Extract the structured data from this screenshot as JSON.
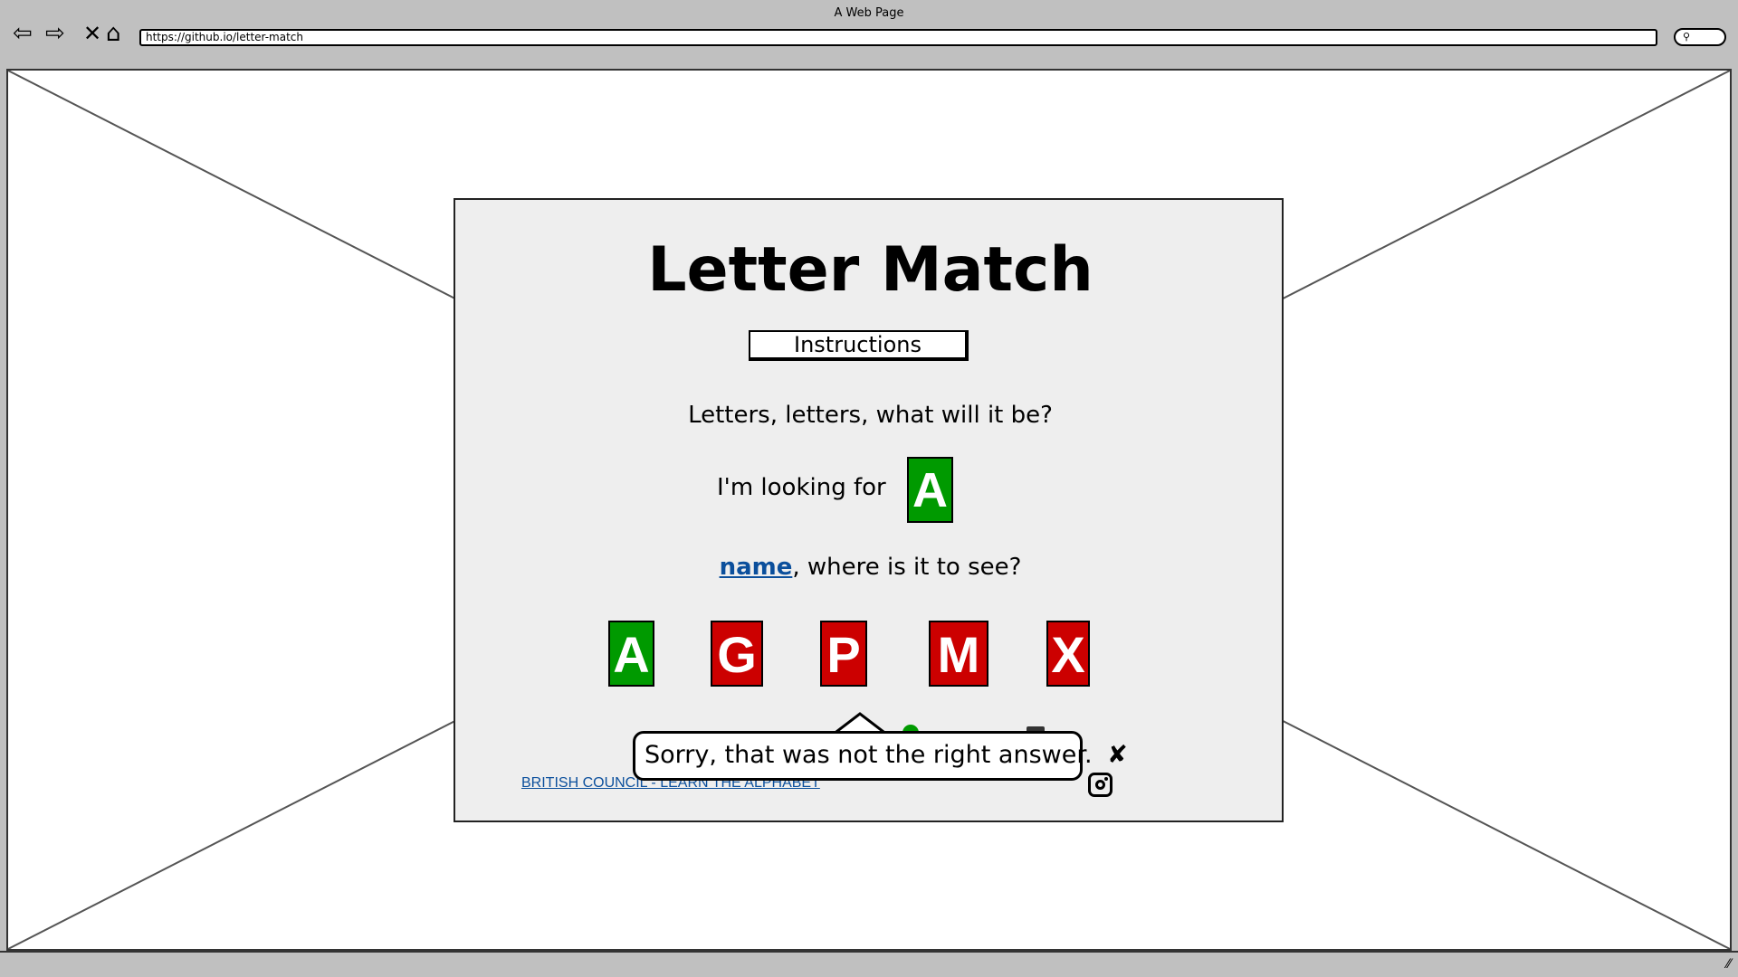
{
  "browser": {
    "title": "A Web Page",
    "url": "https://github.io/letter-match",
    "search_icon": "search-icon"
  },
  "app": {
    "title": "Letter Match",
    "instructions_label": "Instructions",
    "line1": "Letters, letters, what will it be?",
    "looking_for": "I'm looking for",
    "target_letter": "A",
    "name_link": "name",
    "line2_rest": ", where is it to see?",
    "options": [
      {
        "letter": "A",
        "state": "correct"
      },
      {
        "letter": "G",
        "state": "wrong"
      },
      {
        "letter": "P",
        "state": "wrong"
      },
      {
        "letter": "M",
        "state": "wrong"
      },
      {
        "letter": "X",
        "state": "wrong"
      }
    ],
    "feedback": "Sorry, that was not the right answer.",
    "feedback_close": "✘",
    "footer_link": "BRITISH COUNCIL - LEARN THE ALPHABET",
    "social_icon": "instagram-icon"
  },
  "colors": {
    "correct": "#009a00",
    "wrong": "#cc0000",
    "link": "#0b4f9c",
    "card": "#eeeeee"
  }
}
